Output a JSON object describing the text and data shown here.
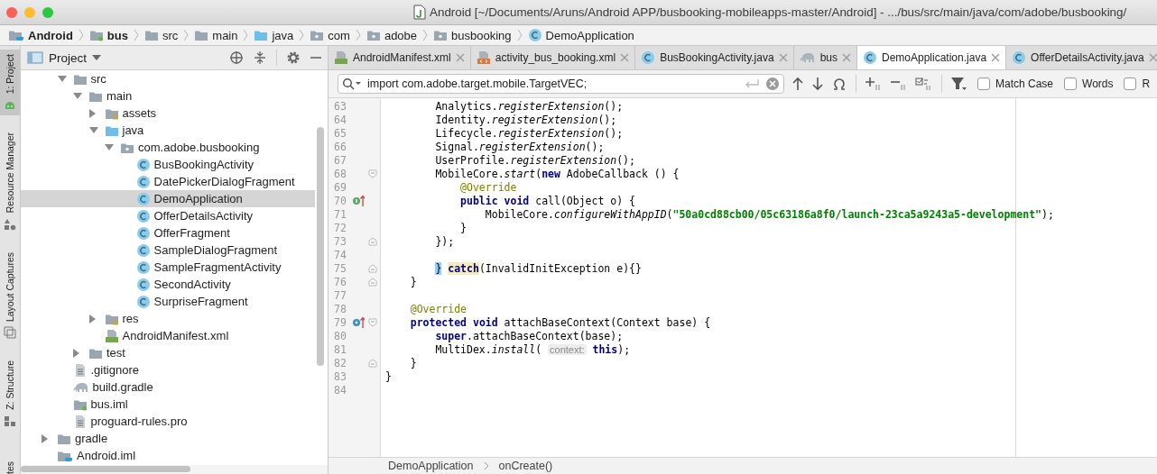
{
  "window": {
    "title": "Android [~/Documents/Aruns/Android APP/busbooking-mobileapps-master/Android] - .../bus/src/main/java/com/adobe/busbooking/"
  },
  "navigation_bar": [
    {
      "label": "Android",
      "kind": "module_android",
      "bold": true
    },
    {
      "label": "bus",
      "kind": "module",
      "bold": true
    },
    {
      "label": "src",
      "kind": "folder",
      "bold": false
    },
    {
      "label": "main",
      "kind": "folder",
      "bold": false
    },
    {
      "label": "java",
      "kind": "source_folder",
      "bold": false
    },
    {
      "label": "com",
      "kind": "package",
      "bold": false
    },
    {
      "label": "adobe",
      "kind": "package",
      "bold": false
    },
    {
      "label": "busbooking",
      "kind": "package",
      "bold": false
    },
    {
      "label": "DemoApplication",
      "kind": "class",
      "bold": false
    }
  ],
  "tool_strip": [
    {
      "label": "1: Project",
      "kind": "android",
      "selected": true
    },
    {
      "label": "Resource Manager",
      "kind": "resources",
      "selected": false
    },
    {
      "label": "Layout Captures",
      "kind": "layout",
      "selected": false
    },
    {
      "label": "Z: Structure",
      "kind": "structure",
      "selected": false
    },
    {
      "label": "tes",
      "selected": false
    }
  ],
  "project_panel": {
    "title": "Project",
    "items": [
      {
        "label": "src",
        "kind": "folder",
        "expanded": true,
        "selected": false,
        "children": [
          {
            "label": "main",
            "kind": "folder",
            "expanded": true,
            "selected": false,
            "children": [
              {
                "label": "assets",
                "kind": "resource_folder",
                "expanded": false,
                "selected": false
              },
              {
                "label": "java",
                "kind": "source_folder",
                "expanded": true,
                "selected": false,
                "children": [
                  {
                    "label": "com.adobe.busbooking",
                    "kind": "package",
                    "expanded": true,
                    "selected": false,
                    "children": [
                      {
                        "label": "BusBookingActivity",
                        "kind": "class",
                        "selected": false
                      },
                      {
                        "label": "DatePickerDialogFragment",
                        "kind": "class",
                        "selected": false
                      },
                      {
                        "label": "DemoApplication",
                        "kind": "class",
                        "selected": true
                      },
                      {
                        "label": "OfferDetailsActivity",
                        "kind": "class",
                        "selected": false
                      },
                      {
                        "label": "OfferFragment",
                        "kind": "class",
                        "selected": false
                      },
                      {
                        "label": "SampleDialogFragment",
                        "kind": "class",
                        "selected": false
                      },
                      {
                        "label": "SampleFragmentActivity",
                        "kind": "class",
                        "selected": false
                      },
                      {
                        "label": "SecondActivity",
                        "kind": "class",
                        "selected": false
                      },
                      {
                        "label": "SurpriseFragment",
                        "kind": "class",
                        "selected": false
                      }
                    ]
                  }
                ]
              },
              {
                "label": "res",
                "kind": "resource_folder",
                "expanded": false,
                "selected": false
              },
              {
                "label": "AndroidManifest.xml",
                "kind": "manifest",
                "selected": false
              }
            ]
          },
          {
            "label": "test",
            "kind": "folder",
            "expanded": false,
            "selected": false
          }
        ]
      },
      {
        "label": ".gitignore",
        "kind": "text_file",
        "selected": false
      },
      {
        "label": "build.gradle",
        "kind": "gradle",
        "selected": false
      },
      {
        "label": "bus.iml",
        "kind": "module",
        "selected": false
      },
      {
        "label": "proguard-rules.pro",
        "kind": "text_file",
        "selected": false
      }
    ],
    "parent_level_items": [
      {
        "label": "gradle",
        "kind": "folder",
        "expanded": false,
        "selected": false
      },
      {
        "label": "Android.iml",
        "kind": "module_android",
        "selected": false
      }
    ]
  },
  "tabs": [
    {
      "label": "AndroidManifest.xml",
      "kind": "manifest",
      "selected": false
    },
    {
      "label": "activity_bus_booking.xml",
      "kind": "xml",
      "selected": false
    },
    {
      "label": "BusBookingActivity.java",
      "kind": "class",
      "selected": false
    },
    {
      "label": "bus",
      "kind": "gradle",
      "selected": false
    },
    {
      "label": "DemoApplication.java",
      "kind": "class",
      "selected": true
    },
    {
      "label": "OfferDetailsActivity.java",
      "kind": "class",
      "selected": false
    }
  ],
  "search": {
    "value": "import com.adobe.target.mobile.TargetVEC;",
    "options": [
      {
        "label": "Match Case",
        "checked": false
      },
      {
        "label": "Words",
        "checked": false
      },
      {
        "label": "R",
        "checked": false
      }
    ]
  },
  "code_lines": [
    {
      "number": "63",
      "tokens": [
        {
          "kind": "plain",
          "text": "        Analytics."
        },
        {
          "kind": "italic",
          "text": "registerExtension"
        },
        {
          "kind": "plain",
          "text": "();"
        }
      ]
    },
    {
      "number": "64",
      "tokens": [
        {
          "kind": "plain",
          "text": "        Identity."
        },
        {
          "kind": "italic",
          "text": "registerExtension"
        },
        {
          "kind": "plain",
          "text": "();"
        }
      ]
    },
    {
      "number": "65",
      "tokens": [
        {
          "kind": "plain",
          "text": "        Lifecycle."
        },
        {
          "kind": "italic",
          "text": "registerExtension"
        },
        {
          "kind": "plain",
          "text": "();"
        }
      ]
    },
    {
      "number": "66",
      "tokens": [
        {
          "kind": "plain",
          "text": "        Signal."
        },
        {
          "kind": "italic",
          "text": "registerExtension"
        },
        {
          "kind": "plain",
          "text": "();"
        }
      ]
    },
    {
      "number": "67",
      "tokens": [
        {
          "kind": "plain",
          "text": "        UserProfile."
        },
        {
          "kind": "italic",
          "text": "registerExtension"
        },
        {
          "kind": "plain",
          "text": "();"
        }
      ]
    },
    {
      "number": "68",
      "fold_start": true,
      "tokens": [
        {
          "kind": "plain",
          "text": "        MobileCore."
        },
        {
          "kind": "italic",
          "text": "start"
        },
        {
          "kind": "plain",
          "text": "("
        },
        {
          "kind": "keyword",
          "text": "new"
        },
        {
          "kind": "plain",
          "text": " AdobeCallback () {"
        }
      ]
    },
    {
      "number": "69",
      "tokens": [
        {
          "kind": "annotation",
          "text": "            @Override"
        }
      ]
    },
    {
      "number": "70",
      "implements": true,
      "tokens": [
        {
          "kind": "keyword",
          "text": "            public"
        },
        {
          "kind": "keyword",
          "text": " void"
        },
        {
          "kind": "plain",
          "text": " call(Object o) {"
        }
      ]
    },
    {
      "number": "71",
      "tokens": [
        {
          "kind": "plain",
          "text": "                MobileCore."
        },
        {
          "kind": "italic",
          "text": "configureWithAppID"
        },
        {
          "kind": "plain",
          "text": "("
        },
        {
          "kind": "string",
          "text": "\"50a0cd88cb00/05c63186a8f0/launch-23ca5a9243a5-development\""
        },
        {
          "kind": "plain",
          "text": ");"
        }
      ]
    },
    {
      "number": "72",
      "tokens": [
        {
          "kind": "plain",
          "text": "            }"
        }
      ]
    },
    {
      "number": "73",
      "fold_end": true,
      "tokens": [
        {
          "kind": "plain",
          "text": "        });"
        }
      ]
    },
    {
      "number": "74"
    },
    {
      "number": "75",
      "fold_end": true,
      "tokens": [
        {
          "kind": "brace_match",
          "text": "        }"
        },
        {
          "kind": "keyword_match",
          "text": " catch"
        },
        {
          "kind": "plain",
          "text": "(InvalidInitException e){}"
        }
      ]
    },
    {
      "number": "76",
      "fold_end": true,
      "tokens": [
        {
          "kind": "plain",
          "text": "    }"
        }
      ]
    },
    {
      "number": "77"
    },
    {
      "number": "78",
      "tokens": [
        {
          "kind": "annotation",
          "text": "    @Override"
        }
      ]
    },
    {
      "number": "79",
      "overrides": true,
      "fold_start": true,
      "tokens": [
        {
          "kind": "keyword",
          "text": "    protected"
        },
        {
          "kind": "keyword",
          "text": " void"
        },
        {
          "kind": "plain",
          "text": " attachBaseContext(Context base) {"
        }
      ]
    },
    {
      "number": "80",
      "tokens": [
        {
          "kind": "keyword",
          "text": "        super"
        },
        {
          "kind": "plain",
          "text": ".attachBaseContext(base);"
        }
      ]
    },
    {
      "number": "81",
      "tokens": [
        {
          "kind": "plain",
          "text": "        MultiDex."
        },
        {
          "kind": "italic",
          "text": "install"
        },
        {
          "kind": "plain",
          "text": "( "
        },
        {
          "kind": "hint",
          "text": "context:"
        },
        {
          "kind": "keyword",
          "text": " this"
        },
        {
          "kind": "plain",
          "text": ");"
        }
      ]
    },
    {
      "number": "82",
      "fold_end": true,
      "tokens": [
        {
          "kind": "plain",
          "text": "    }"
        }
      ]
    },
    {
      "number": "83",
      "tokens": [
        {
          "kind": "plain",
          "text": "}"
        }
      ]
    },
    {
      "number": "84"
    }
  ],
  "status_breadcrumb": [
    "DemoApplication",
    "onCreate()"
  ]
}
